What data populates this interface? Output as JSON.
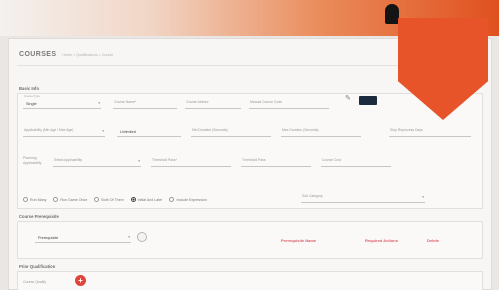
{
  "header": {
    "title": "COURSES",
    "breadcrumb": "Home  >  Qualifications  >  Course"
  },
  "basic_info": {
    "section_label": "Basic Info",
    "type_field": {
      "caption": "Course Type",
      "value": "Single"
    },
    "course_name_label": "Course Name*",
    "course_abbrev_label": "Course Abbrev",
    "manual_code_label": "Manual Course Code",
    "applicability_label": "Applicability (Min Age / Max Age)",
    "duration_value": "Unlimited",
    "min_duration_label": "Min Duration (Seconds)",
    "max_duration_label": "Max Duration (Seconds)",
    "reprocess_label": "Stop Reprocess Days",
    "planning_label": "Planning Applicability",
    "planning_select": "Select Applicability",
    "prereq_label": "Threshold Pass",
    "threshold_label": "Threshold Pass*",
    "course_cost_label": "Course Cost"
  },
  "radios": [
    {
      "label": "Run Many",
      "checked": false
    },
    {
      "label": "Run Game Once",
      "checked": false
    },
    {
      "label": "Both Of Them",
      "checked": false
    },
    {
      "label": "Initial And Later",
      "checked": true
    },
    {
      "label": "Include Expression",
      "checked": false
    }
  ],
  "radio_select": "Sub Category",
  "prerequisite": {
    "section_label": "Course Prerequisite",
    "select_value": "Prerequisite",
    "col1": "Prerequisite Name",
    "col2": "Required Actions",
    "col3": "Delete"
  },
  "qualification": {
    "section_label": "Prior Qualification",
    "add_label": "Course Qualify"
  },
  "colors": {
    "accent": "#e8542a",
    "swatch": "#1b2a3c",
    "danger": "#d9606a"
  }
}
